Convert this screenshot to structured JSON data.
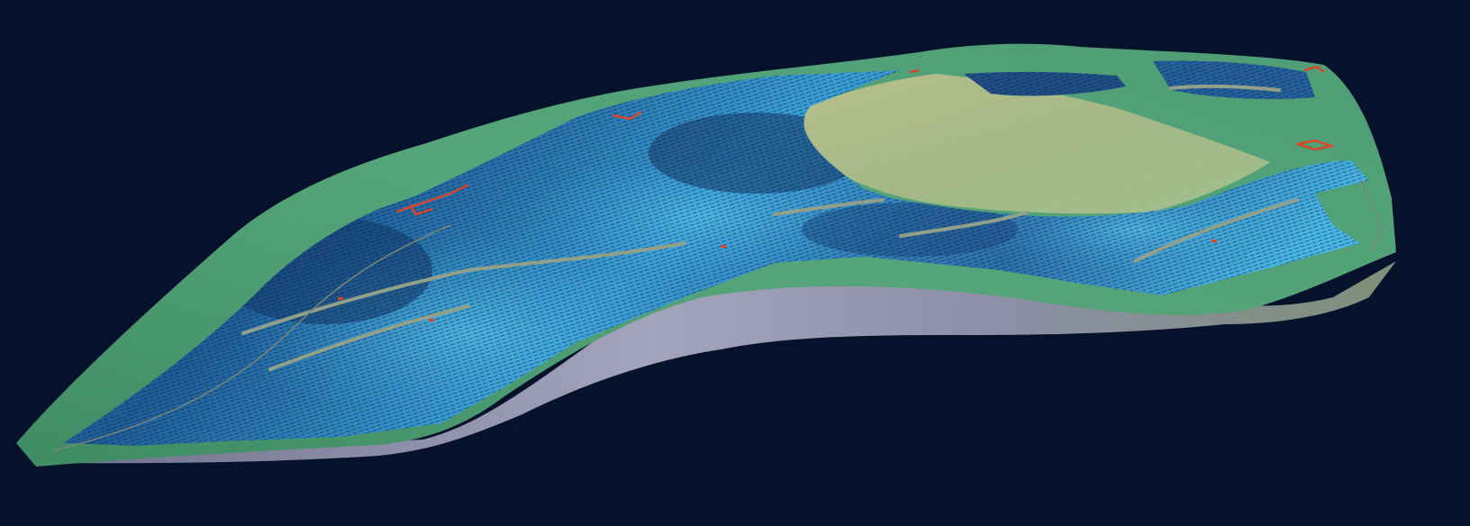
{
  "viewport": {
    "background_color": "#06122b"
  },
  "scene": {
    "terrain_colors": {
      "shoulder_green": "#4e9b72",
      "pad_khaki": "#a9b985",
      "side_wall_grey": "#8d8fa8",
      "panel_deep_blue": "#1d4f86",
      "panel_mid_blue": "#2e7fbe",
      "panel_light_cyan": "#47b6e6",
      "road_grey": "#93a089",
      "equipment_red": "#d8452a"
    },
    "objects": [
      {
        "name": "terrain-mesh",
        "type": "mesh"
      },
      {
        "name": "solar-panel-array",
        "type": "instances"
      },
      {
        "name": "access-road-network",
        "type": "polyline"
      },
      {
        "name": "inverter-station",
        "type": "instances"
      }
    ]
  }
}
